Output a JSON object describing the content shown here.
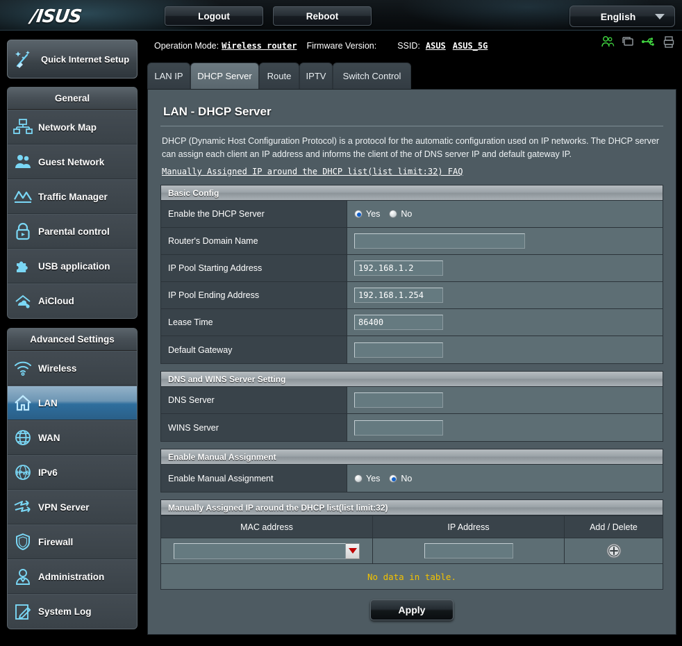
{
  "brand": {
    "logo_text": "/ISUS"
  },
  "topbar": {
    "logout_label": "Logout",
    "reboot_label": "Reboot",
    "language_label": "English"
  },
  "header_info": {
    "operation_mode_label": "Operation Mode:",
    "operation_mode_value": "Wireless router",
    "firmware_label": "Firmware Version:",
    "firmware_value": "",
    "ssid_label": "SSID:",
    "ssid_values": [
      "ASUS",
      "ASUS_5G"
    ]
  },
  "status_icons": [
    {
      "name": "clients-icon",
      "color": "#3fd13f"
    },
    {
      "name": "screens-icon",
      "color": "#8d9499"
    },
    {
      "name": "usb-icon",
      "color": "#3fd13f"
    },
    {
      "name": "printer-icon",
      "color": "#8d9499"
    }
  ],
  "sidebar": {
    "quick_setup_label": "Quick Internet Setup",
    "groups": [
      {
        "title": "General",
        "items": [
          {
            "label": "Network Map",
            "icon": "network-map-icon",
            "active": false
          },
          {
            "label": "Guest Network",
            "icon": "guest-network-icon",
            "active": false
          },
          {
            "label": "Traffic Manager",
            "icon": "traffic-manager-icon",
            "active": false
          },
          {
            "label": "Parental control",
            "icon": "lock-icon",
            "active": false
          },
          {
            "label": "USB application",
            "icon": "puzzle-icon",
            "active": false
          },
          {
            "label": "AiCloud",
            "icon": "aicloud-icon",
            "active": false
          }
        ]
      },
      {
        "title": "Advanced Settings",
        "items": [
          {
            "label": "Wireless",
            "icon": "wifi-icon",
            "active": false
          },
          {
            "label": "LAN",
            "icon": "home-icon",
            "active": true
          },
          {
            "label": "WAN",
            "icon": "globe-icon",
            "active": false
          },
          {
            "label": "IPv6",
            "icon": "ipv6-icon",
            "active": false
          },
          {
            "label": "VPN Server",
            "icon": "vpn-icon",
            "active": false
          },
          {
            "label": "Firewall",
            "icon": "shield-icon",
            "active": false
          },
          {
            "label": "Administration",
            "icon": "user-icon",
            "active": false
          },
          {
            "label": "System Log",
            "icon": "system-log-icon",
            "active": false
          }
        ]
      }
    ]
  },
  "tabs": [
    {
      "label": "LAN IP",
      "active": false
    },
    {
      "label": "DHCP Server",
      "active": true
    },
    {
      "label": "Route",
      "active": false
    },
    {
      "label": "IPTV",
      "active": false
    },
    {
      "label": "Switch Control",
      "active": false
    }
  ],
  "page": {
    "title": "LAN - DHCP Server",
    "description": "DHCP (Dynamic Host Configuration Protocol) is a protocol for the automatic configuration used on IP networks. The DHCP server can assign each client an IP address and informs the client of the of DNS server IP and default gateway IP.",
    "faq_link": "Manually Assigned IP around the DHCP list(list limit:32) FAQ"
  },
  "basic_config": {
    "section_title": "Basic Config",
    "rows": [
      {
        "label": "Enable the DHCP Server",
        "type": "radio",
        "options": [
          "Yes",
          "No"
        ],
        "selected": "Yes"
      },
      {
        "label": "Router's Domain Name",
        "type": "text",
        "value": "",
        "width": "wide"
      },
      {
        "label": "IP Pool Starting Address",
        "type": "text",
        "value": "192.168.1.2",
        "width": "small"
      },
      {
        "label": "IP Pool Ending Address",
        "type": "text",
        "value": "192.168.1.254",
        "width": "small"
      },
      {
        "label": "Lease Time",
        "type": "text",
        "value": "86400",
        "width": "small"
      },
      {
        "label": "Default Gateway",
        "type": "text",
        "value": "",
        "width": "small"
      }
    ]
  },
  "dns_wins": {
    "section_title": "DNS and WINS Server Setting",
    "rows": [
      {
        "label": "DNS Server",
        "type": "text",
        "value": "",
        "width": "small"
      },
      {
        "label": "WINS Server",
        "type": "text",
        "value": "",
        "width": "small"
      }
    ]
  },
  "manual_assignment": {
    "section_title": "Enable Manual Assignment",
    "rows": [
      {
        "label": "Enable Manual Assignment",
        "type": "radio",
        "options": [
          "Yes",
          "No"
        ],
        "selected": "No"
      }
    ]
  },
  "mac_table": {
    "section_title": "Manually Assigned IP around the DHCP list(list limit:32)",
    "columns": [
      "MAC address",
      "IP Address",
      "Add / Delete"
    ],
    "entry_row": {
      "mac_value": "",
      "ip_value": "",
      "add_icon": "plus-circle-icon"
    },
    "empty_message": "No data in table.",
    "empty_message_color": "#f2c200"
  },
  "footer": {
    "apply_label": "Apply"
  }
}
